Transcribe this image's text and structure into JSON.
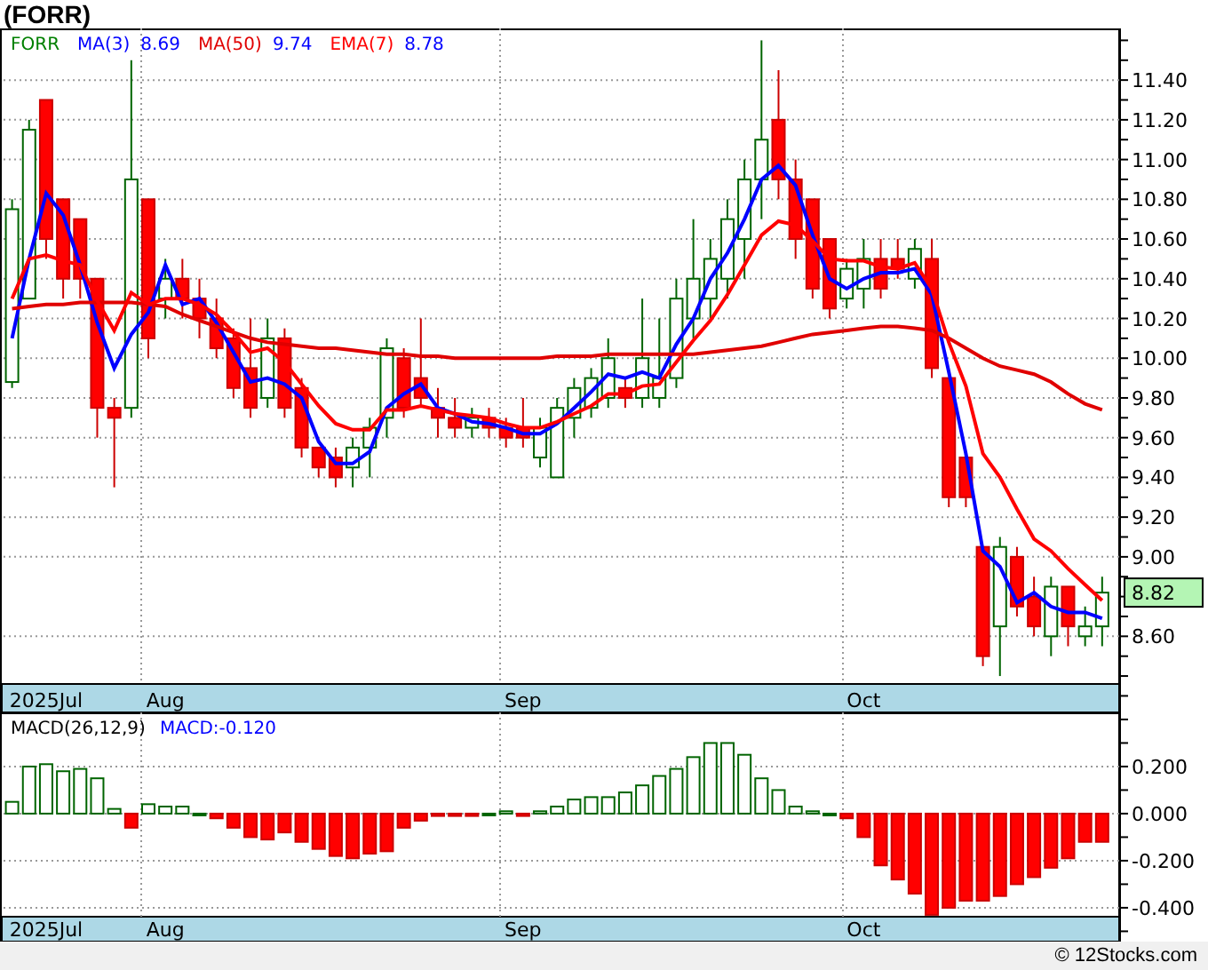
{
  "title": "(FORR)",
  "price_panel": {
    "symbol": "FORR",
    "legend_values": [
      "8.69",
      "9.74",
      "8.78"
    ],
    "last_price": "8.82",
    "chart_data": {
      "type": "candlestick",
      "grid": true,
      "categories": [
        null,
        null,
        "2025Jul",
        null,
        null,
        null,
        null,
        null,
        null,
        "Aug",
        null,
        null,
        null,
        null,
        null,
        null,
        null,
        null,
        null,
        null,
        null,
        null,
        null,
        null,
        null,
        null,
        null,
        null,
        null,
        null,
        "Sep",
        null,
        null,
        null,
        null,
        null,
        null,
        null,
        null,
        null,
        null,
        null,
        null,
        null,
        null,
        null,
        null,
        null,
        null,
        null,
        "Oct",
        null,
        null,
        null,
        null,
        null,
        null,
        null,
        null,
        null,
        null,
        null,
        null,
        null,
        null
      ],
      "ylim": [
        8.36,
        11.66
      ],
      "yticks": [
        {
          "value": 8.6,
          "label": "8.60"
        },
        {
          "value": 9.0,
          "label": "9.00"
        },
        {
          "value": 9.2,
          "label": "9.20"
        },
        {
          "value": 9.4,
          "label": "9.40"
        },
        {
          "value": 9.6,
          "label": "9.60"
        },
        {
          "value": 9.8,
          "label": "9.80"
        },
        {
          "value": 10.0,
          "label": "10.00"
        },
        {
          "value": 10.2,
          "label": "10.20"
        },
        {
          "value": 10.4,
          "label": "10.40"
        },
        {
          "value": 10.6,
          "label": "10.60"
        },
        {
          "value": 10.8,
          "label": "10.80"
        },
        {
          "value": 11.0,
          "label": "11.00"
        },
        {
          "value": 11.2,
          "label": "11.20"
        },
        {
          "value": 11.4,
          "label": "11.40"
        }
      ],
      "ohlc": [
        [
          9.88,
          10.8,
          9.85,
          10.75
        ],
        [
          10.3,
          11.2,
          10.3,
          11.15
        ],
        [
          11.3,
          11.3,
          10.5,
          10.6
        ],
        [
          10.8,
          10.8,
          10.3,
          10.4
        ],
        [
          10.7,
          10.7,
          10.3,
          10.4
        ],
        [
          10.4,
          10.4,
          9.6,
          9.75
        ],
        [
          9.75,
          9.8,
          9.35,
          9.7
        ],
        [
          9.75,
          11.5,
          9.7,
          10.9
        ],
        [
          10.8,
          10.8,
          10.0,
          10.1
        ],
        [
          10.3,
          10.5,
          10.2,
          10.4
        ],
        [
          10.4,
          10.5,
          10.2,
          10.3
        ],
        [
          10.3,
          10.4,
          10.1,
          10.2
        ],
        [
          10.2,
          10.3,
          10.0,
          10.05
        ],
        [
          10.1,
          10.15,
          9.8,
          9.85
        ],
        [
          9.95,
          10.2,
          9.7,
          9.75
        ],
        [
          9.8,
          10.2,
          9.75,
          10.1
        ],
        [
          10.1,
          10.15,
          9.7,
          9.75
        ],
        [
          9.85,
          9.9,
          9.5,
          9.55
        ],
        [
          9.55,
          9.55,
          9.4,
          9.45
        ],
        [
          9.5,
          9.55,
          9.35,
          9.4
        ],
        [
          9.45,
          9.6,
          9.35,
          9.55
        ],
        [
          9.55,
          9.7,
          9.4,
          9.65
        ],
        [
          9.7,
          10.1,
          9.6,
          10.05
        ],
        [
          10.0,
          10.05,
          9.7,
          9.75
        ],
        [
          9.9,
          10.2,
          9.75,
          9.8
        ],
        [
          9.75,
          9.85,
          9.6,
          9.7
        ],
        [
          9.7,
          9.8,
          9.6,
          9.65
        ],
        [
          9.65,
          9.75,
          9.6,
          9.7
        ],
        [
          9.7,
          9.75,
          9.6,
          9.65
        ],
        [
          9.65,
          9.7,
          9.55,
          9.6
        ],
        [
          9.65,
          9.8,
          9.55,
          9.6
        ],
        [
          9.5,
          9.7,
          9.45,
          9.65
        ],
        [
          9.4,
          9.8,
          9.4,
          9.75
        ],
        [
          9.7,
          9.9,
          9.6,
          9.85
        ],
        [
          9.75,
          9.95,
          9.7,
          9.9
        ],
        [
          9.8,
          10.1,
          9.75,
          10.0
        ],
        [
          9.85,
          9.9,
          9.75,
          9.8
        ],
        [
          9.8,
          10.3,
          9.75,
          10.0
        ],
        [
          9.8,
          10.2,
          9.75,
          9.9
        ],
        [
          9.9,
          10.4,
          9.85,
          10.3
        ],
        [
          10.2,
          10.7,
          10.1,
          10.4
        ],
        [
          10.3,
          10.6,
          10.2,
          10.5
        ],
        [
          10.4,
          10.8,
          10.3,
          10.7
        ],
        [
          10.6,
          11.0,
          10.4,
          10.9
        ],
        [
          10.9,
          11.6,
          10.7,
          11.1
        ],
        [
          11.2,
          11.45,
          10.8,
          10.9
        ],
        [
          10.9,
          11.0,
          10.5,
          10.6
        ],
        [
          10.8,
          10.8,
          10.3,
          10.35
        ],
        [
          10.6,
          10.6,
          10.2,
          10.25
        ],
        [
          10.3,
          10.5,
          10.25,
          10.45
        ],
        [
          10.35,
          10.6,
          10.25,
          10.5
        ],
        [
          10.5,
          10.6,
          10.3,
          10.35
        ],
        [
          10.5,
          10.6,
          10.4,
          10.45
        ],
        [
          10.4,
          10.6,
          10.35,
          10.55
        ],
        [
          10.5,
          10.6,
          9.9,
          9.95
        ],
        [
          9.9,
          9.9,
          9.25,
          9.3
        ],
        [
          9.5,
          9.5,
          9.25,
          9.3
        ],
        [
          9.05,
          9.05,
          8.45,
          8.5
        ],
        [
          8.65,
          9.1,
          8.4,
          9.05
        ],
        [
          9.0,
          9.05,
          8.7,
          8.75
        ],
        [
          8.8,
          8.9,
          8.6,
          8.65
        ],
        [
          8.6,
          8.9,
          8.5,
          8.85
        ],
        [
          8.85,
          8.85,
          8.55,
          8.65
        ],
        [
          8.6,
          8.75,
          8.55,
          8.65
        ],
        [
          8.65,
          8.9,
          8.55,
          8.82
        ]
      ],
      "series": [
        {
          "name": "MA(3)",
          "type": "line",
          "color": "#0000ff",
          "values": [
            10.1,
            10.5,
            10.83,
            10.72,
            10.47,
            10.18,
            9.95,
            10.12,
            10.23,
            10.47,
            10.27,
            10.3,
            10.18,
            10.03,
            9.88,
            9.9,
            9.87,
            9.8,
            9.58,
            9.47,
            9.47,
            9.53,
            9.75,
            9.82,
            9.87,
            9.75,
            9.72,
            9.68,
            9.67,
            9.65,
            9.62,
            9.62,
            9.67,
            9.75,
            9.83,
            9.92,
            9.9,
            9.93,
            9.9,
            10.07,
            10.2,
            10.4,
            10.53,
            10.7,
            10.9,
            10.97,
            10.87,
            10.62,
            10.4,
            10.35,
            10.4,
            10.43,
            10.43,
            10.45,
            10.32,
            9.93,
            9.52,
            9.03,
            8.95,
            8.77,
            8.82,
            8.75,
            8.72,
            8.72,
            8.69
          ]
        },
        {
          "name": "MA(50)",
          "type": "line",
          "color": "#e00000",
          "values": [
            10.25,
            10.26,
            10.27,
            10.27,
            10.28,
            10.28,
            10.28,
            10.28,
            10.27,
            10.26,
            10.22,
            10.19,
            10.16,
            10.13,
            10.1,
            10.08,
            10.07,
            10.06,
            10.05,
            10.05,
            10.04,
            10.03,
            10.02,
            10.02,
            10.01,
            10.01,
            10.0,
            10.0,
            10.0,
            10.0,
            10.0,
            10.0,
            10.01,
            10.01,
            10.01,
            10.02,
            10.02,
            10.02,
            10.02,
            10.02,
            10.02,
            10.03,
            10.04,
            10.05,
            10.06,
            10.08,
            10.1,
            10.12,
            10.13,
            10.14,
            10.15,
            10.16,
            10.16,
            10.15,
            10.14,
            10.1,
            10.05,
            10.0,
            9.96,
            9.94,
            9.92,
            9.88,
            9.82,
            9.77,
            9.74
          ]
        },
        {
          "name": "EMA(7)",
          "type": "line",
          "color": "#ff0000",
          "values": [
            10.3,
            10.5,
            10.52,
            10.49,
            10.47,
            10.29,
            10.14,
            10.33,
            10.27,
            10.3,
            10.3,
            10.27,
            10.22,
            10.13,
            10.03,
            10.05,
            9.98,
            9.87,
            9.76,
            9.67,
            9.64,
            9.64,
            9.74,
            9.74,
            9.76,
            9.74,
            9.72,
            9.71,
            9.7,
            9.67,
            9.65,
            9.65,
            9.68,
            9.72,
            9.76,
            9.82,
            9.82,
            9.86,
            9.87,
            9.98,
            10.09,
            10.19,
            10.32,
            10.47,
            10.62,
            10.69,
            10.67,
            10.59,
            10.5,
            10.49,
            10.49,
            10.46,
            10.45,
            10.48,
            10.35,
            10.08,
            9.86,
            9.52,
            9.4,
            9.24,
            9.09,
            9.03,
            8.94,
            8.86,
            8.78
          ]
        }
      ]
    }
  },
  "macd_panel": {
    "legend_value": "MACD:-0.120",
    "chart_data": {
      "type": "bar",
      "grid": true,
      "categories": [
        null,
        null,
        "2025Jul",
        null,
        null,
        null,
        null,
        null,
        null,
        "Aug",
        null,
        null,
        null,
        null,
        null,
        null,
        null,
        null,
        null,
        null,
        null,
        null,
        null,
        null,
        null,
        null,
        null,
        null,
        null,
        null,
        "Sep",
        null,
        null,
        null,
        null,
        null,
        null,
        null,
        null,
        null,
        null,
        null,
        null,
        null,
        null,
        null,
        null,
        null,
        null,
        null,
        "Oct",
        null,
        null,
        null,
        null,
        null,
        null,
        null,
        null,
        null,
        null,
        null,
        null,
        null,
        null
      ],
      "ylim": [
        -0.438,
        0.43
      ],
      "yticks": [
        {
          "value": -0.4,
          "label": "-0.400"
        },
        {
          "value": -0.2,
          "label": "-0.200"
        },
        {
          "value": 0,
          "label": "0.000"
        },
        {
          "value": 0.2,
          "label": "0.200"
        }
      ],
      "series": [
        {
          "name": "MACD(26,12,9)",
          "values": [
            0.05,
            0.2,
            0.21,
            0.18,
            0.19,
            0.15,
            0.02,
            -0.06,
            0.04,
            0.03,
            0.03,
            0.0,
            -0.02,
            -0.06,
            -0.1,
            -0.11,
            -0.08,
            -0.12,
            -0.15,
            -0.18,
            -0.19,
            -0.17,
            -0.16,
            -0.06,
            -0.03,
            -0.01,
            -0.01,
            -0.01,
            0.0,
            0.01,
            -0.01,
            0.01,
            0.03,
            0.06,
            0.07,
            0.07,
            0.09,
            0.12,
            0.16,
            0.19,
            0.24,
            0.3,
            0.3,
            0.25,
            0.15,
            0.1,
            0.03,
            0.01,
            0.0,
            -0.02,
            -0.1,
            -0.22,
            -0.28,
            -0.34,
            -0.43,
            -0.4,
            -0.37,
            -0.37,
            -0.35,
            -0.3,
            -0.27,
            -0.23,
            -0.19,
            -0.12,
            -0.12
          ]
        }
      ]
    }
  },
  "footer": "© 12Stocks.com"
}
